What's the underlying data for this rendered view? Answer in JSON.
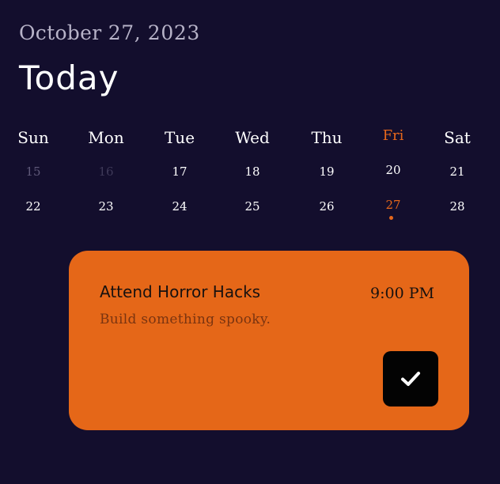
{
  "header": {
    "date_month": "October",
    "date_rest": "27, 2023",
    "title": "Today"
  },
  "calendar": {
    "weekdays": [
      "Sun",
      "Mon",
      "Tue",
      "Wed",
      "Thu",
      "Fri",
      "Sat"
    ],
    "selected_weekday": "Fri",
    "week1": [
      "15",
      "16",
      "17",
      "18",
      "19",
      "20",
      "21"
    ],
    "week2": [
      "22",
      "23",
      "24",
      "25",
      "26",
      "27",
      "28"
    ],
    "selected_day": "27"
  },
  "event": {
    "title": "Attend Horror Hacks",
    "time": "9:00 PM",
    "description": "Build something spooky.",
    "complete_icon": "check-icon"
  },
  "colors": {
    "background": "#130e2d",
    "accent": "#e56718",
    "button": "#030303"
  }
}
